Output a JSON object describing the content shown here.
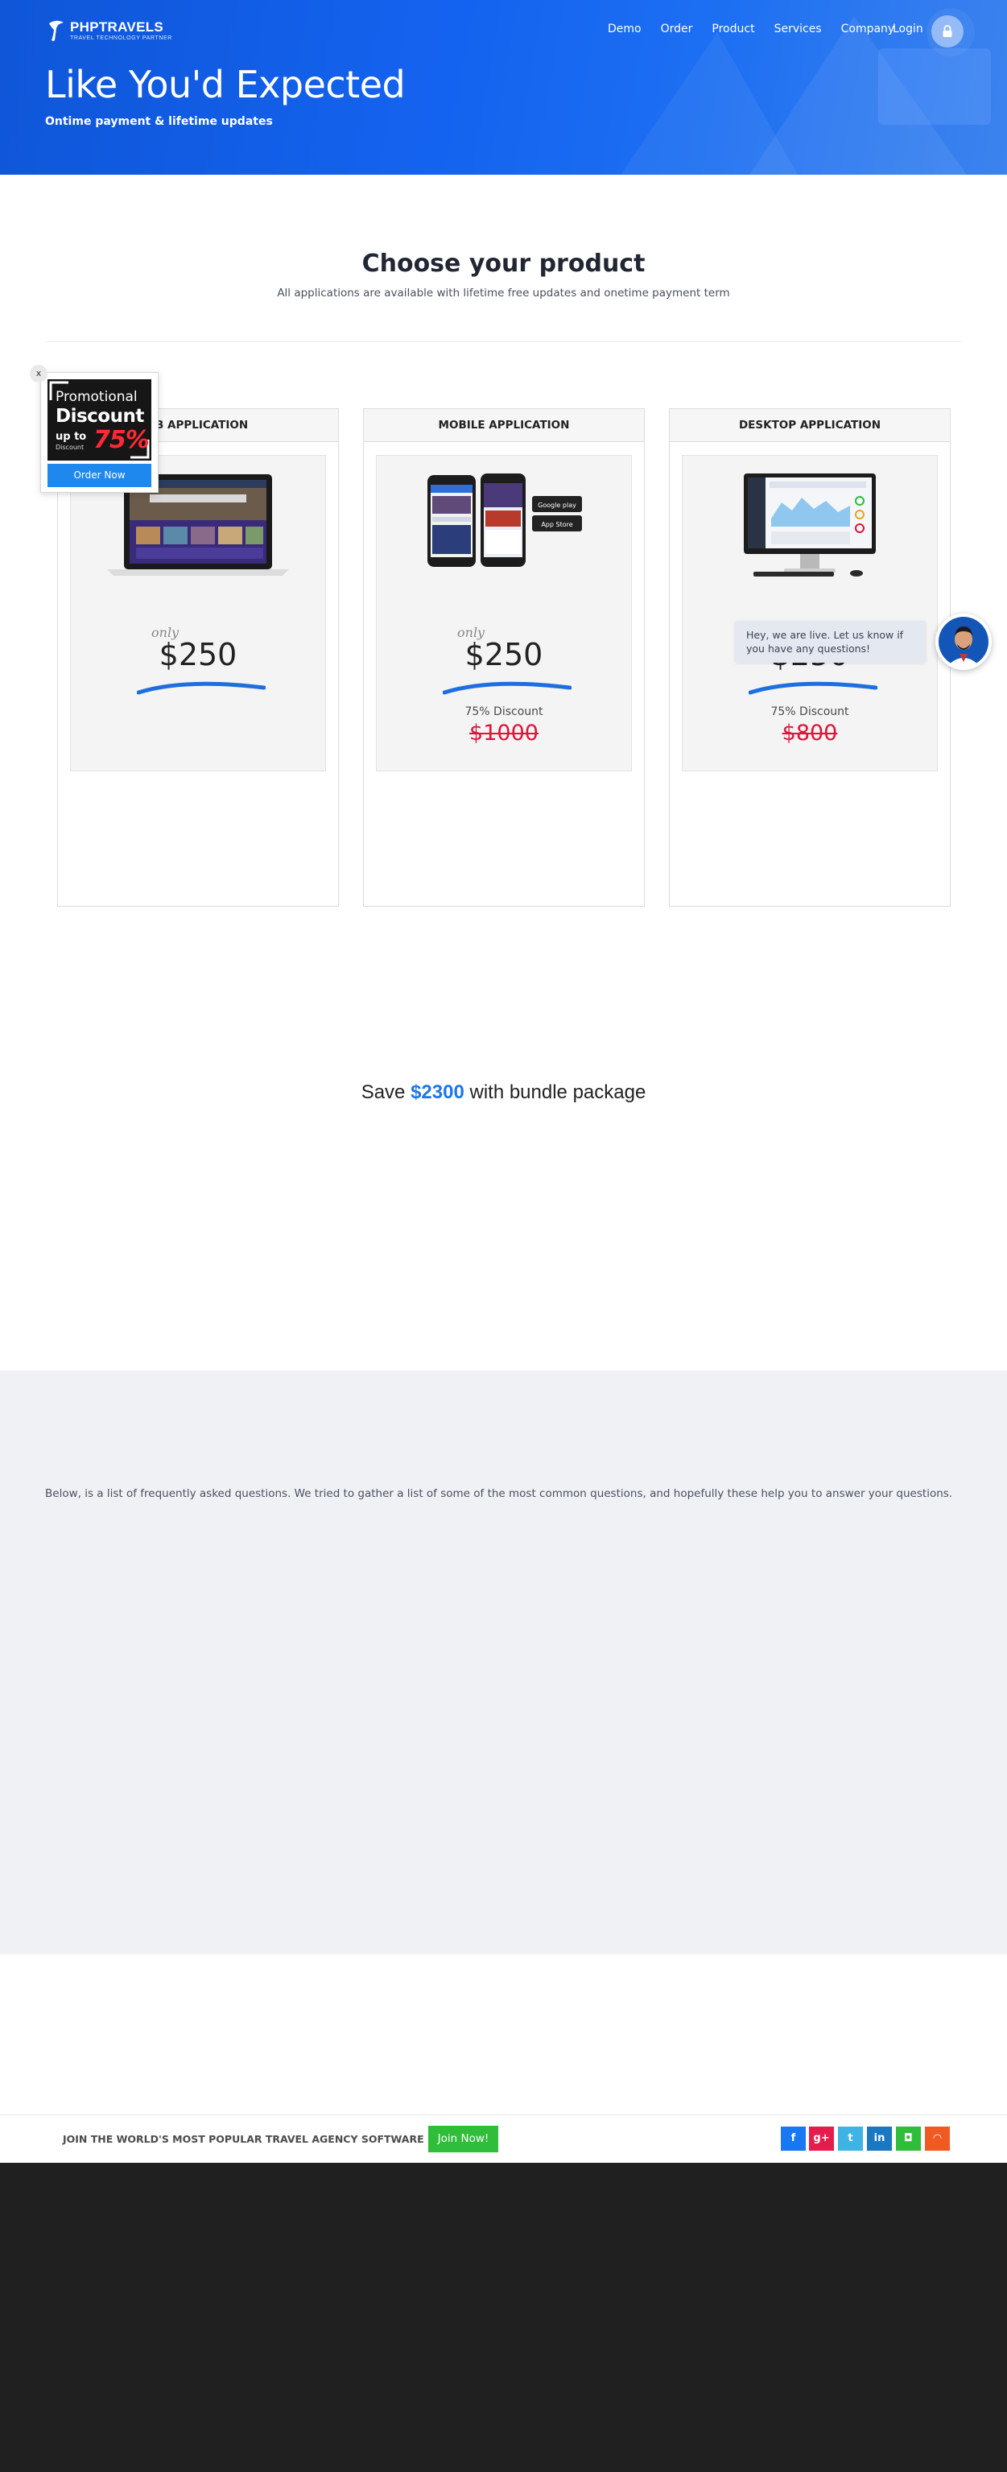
{
  "brand": {
    "name": "PHPTRAVELS",
    "tagline": "TRAVEL TECHNOLOGY PARTNER"
  },
  "nav": {
    "items": [
      "Demo",
      "Order",
      "Product",
      "Services",
      "Company"
    ],
    "login": "Login"
  },
  "hero": {
    "title": "Like You'd Expected",
    "subtitle": "Ontime payment & lifetime updates"
  },
  "products": {
    "title": "Choose your product",
    "subtitle": "All applications are available with lifetime free updates and onetime payment term",
    "cards": [
      {
        "name": "WEB APPLICATION",
        "name_visible": "EB APPLICATION",
        "only": "only",
        "price": "$250",
        "discount": "",
        "old_price": ""
      },
      {
        "name": "MOBILE APPLICATION",
        "only": "only",
        "price": "$250",
        "discount": "75% Discount",
        "old_price": "$1000"
      },
      {
        "name": "DESKTOP APPLICATION",
        "only": "",
        "price": "$250",
        "discount": "75% Discount",
        "old_price": "$800"
      }
    ]
  },
  "promo": {
    "close": "x",
    "line1": "Promotional",
    "line2": "Discount",
    "upto": "up to",
    "percent": "75%",
    "discount_word": "Discount",
    "button": "Order Now"
  },
  "chat": {
    "message": "Hey, we are live. Let us know if you have any questions!"
  },
  "bundle": {
    "prefix": "Save ",
    "amount": "$2300",
    "suffix": " with bundle package"
  },
  "faq": {
    "intro": "Below, is a list of frequently asked questions. We tried to gather a list of some of the most common questions, and hopefully these help you to answer your questions."
  },
  "join": {
    "text": "JOIN THE WORLD'S MOST POPULAR TRAVEL AGENCY SOFTWARE",
    "button": "Join Now!",
    "social": [
      {
        "icon": "facebook-icon",
        "glyph": "f",
        "color": "#1877f2"
      },
      {
        "icon": "google-plus-icon",
        "glyph": "g+",
        "color": "#e41d4c"
      },
      {
        "icon": "twitter-icon",
        "glyph": "t",
        "color": "#3fb3e6"
      },
      {
        "icon": "linkedin-icon",
        "glyph": "in",
        "color": "#1a78c2"
      },
      {
        "icon": "instagram-icon",
        "glyph": "◘",
        "color": "#2fbd3a"
      },
      {
        "icon": "rss-icon",
        "glyph": "◠",
        "color": "#f05a22"
      }
    ]
  },
  "colors": {
    "hero_blue": "#1463f0",
    "accent": "#1d77e8",
    "strike": "#e0133a",
    "join_green": "#2fbd3a",
    "footer": "#202020"
  }
}
